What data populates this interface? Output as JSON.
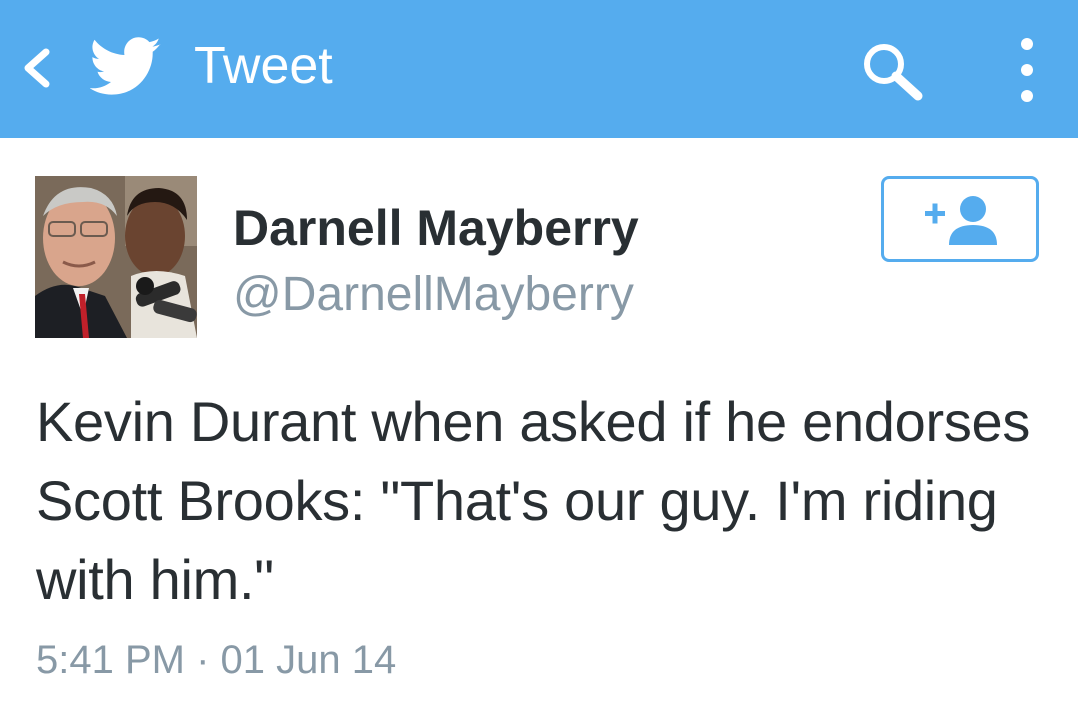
{
  "appbar": {
    "title": "Tweet",
    "background_color": "#55acee",
    "icons": {
      "back": "back-arrow-icon",
      "brand": "twitter-bird-icon",
      "search": "search-icon",
      "overflow": "overflow-menu-icon"
    }
  },
  "tweet": {
    "author": {
      "name": "Darnell Mayberry",
      "handle": "@DarnellMayberry",
      "avatar": "avatar-photo"
    },
    "follow_button": {
      "icon": "add-user-icon",
      "color": "#55acee"
    },
    "text": "Kevin Durant when asked if he endorses Scott Brooks: \"That's our guy. I'm riding with him.\"",
    "time": "5:41 PM",
    "separator": "·",
    "date": "01 Jun 14"
  }
}
